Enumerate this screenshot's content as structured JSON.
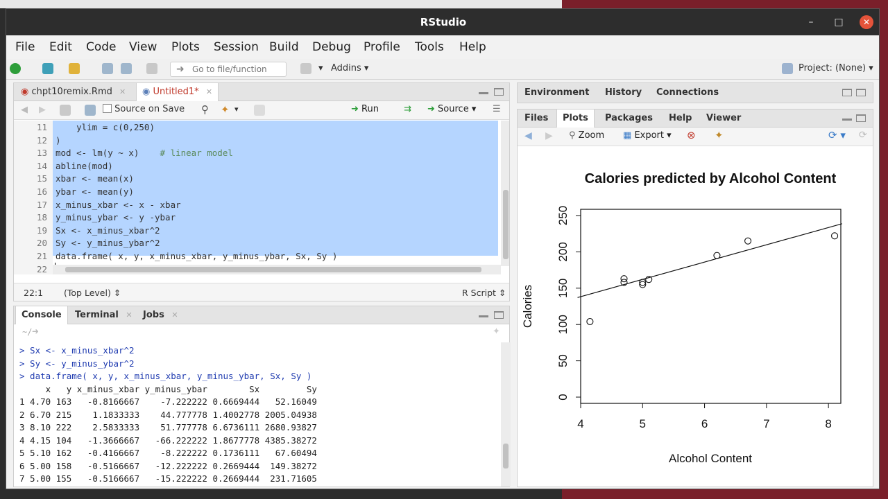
{
  "window": {
    "title": "RStudio"
  },
  "menu": [
    "File",
    "Edit",
    "Code",
    "View",
    "Plots",
    "Session",
    "Build",
    "Debug",
    "Profile",
    "Tools",
    "Help"
  ],
  "toolbar": {
    "goto_placeholder": "Go to file/function",
    "addins": "Addins",
    "project": "Project: (None)"
  },
  "editor": {
    "tabs": [
      {
        "label": "chpt10remix.Rmd"
      },
      {
        "label": "Untitled1*"
      }
    ],
    "source_on_save": "Source on Save",
    "run": "Run",
    "source": "Source",
    "lines": [
      {
        "n": "11",
        "code": "    ylim = c(0,250)",
        "comment": ""
      },
      {
        "n": "12",
        "code": ")",
        "comment": ""
      },
      {
        "n": "13",
        "code": "mod <- lm(y ~ x)    ",
        "comment": "# linear model"
      },
      {
        "n": "14",
        "code": "abline(mod)",
        "comment": ""
      },
      {
        "n": "15",
        "code": "xbar <- mean(x)",
        "comment": ""
      },
      {
        "n": "16",
        "code": "ybar <- mean(y)",
        "comment": ""
      },
      {
        "n": "17",
        "code": "x_minus_xbar <- x - xbar",
        "comment": ""
      },
      {
        "n": "18",
        "code": "y_minus_ybar <- y -ybar",
        "comment": ""
      },
      {
        "n": "19",
        "code": "Sx <- x_minus_xbar^2",
        "comment": ""
      },
      {
        "n": "20",
        "code": "Sy <- y_minus_ybar^2",
        "comment": ""
      },
      {
        "n": "21",
        "code": "data.frame( x, y, x_minus_xbar, y_minus_ybar, Sx, Sy )",
        "comment": ""
      },
      {
        "n": "22",
        "code": "",
        "comment": ""
      }
    ],
    "status": {
      "position": "22:1",
      "scope": "(Top Level)",
      "filetype": "R Script"
    }
  },
  "console": {
    "tabs": [
      {
        "label": "Console"
      },
      {
        "label": "Terminal"
      },
      {
        "label": "Jobs"
      }
    ],
    "path": "~/",
    "lines": [
      {
        "text": "> Sx <- x_minus_xbar^2",
        "cmd": true
      },
      {
        "text": "> Sy <- y_minus_ybar^2",
        "cmd": true
      },
      {
        "text": "> data.frame( x, y, x_minus_xbar, y_minus_ybar, Sx, Sy )",
        "cmd": true
      },
      {
        "text": "     x   y x_minus_xbar y_minus_ybar        Sx         Sy",
        "cmd": false
      },
      {
        "text": "1 4.70 163   -0.8166667    -7.222222 0.6669444   52.16049",
        "cmd": false
      },
      {
        "text": "2 6.70 215    1.1833333    44.777778 1.4002778 2005.04938",
        "cmd": false
      },
      {
        "text": "3 8.10 222    2.5833333    51.777778 6.6736111 2680.93827",
        "cmd": false
      },
      {
        "text": "4 4.15 104   -1.3666667   -66.222222 1.8677778 4385.38272",
        "cmd": false
      },
      {
        "text": "5 5.10 162   -0.4166667    -8.222222 0.1736111   67.60494",
        "cmd": false
      },
      {
        "text": "6 5.00 158   -0.5166667   -12.222222 0.2669444  149.38272",
        "cmd": false
      },
      {
        "text": "7 5.00 155   -0.5166667   -15.222222 0.2669444  231.71605",
        "cmd": false
      }
    ]
  },
  "env": {
    "tabs": [
      {
        "label": "Environment"
      },
      {
        "label": "History"
      },
      {
        "label": "Connections"
      }
    ]
  },
  "plots": {
    "tabs": [
      {
        "label": "Files"
      },
      {
        "label": "Plots"
      },
      {
        "label": "Packages"
      },
      {
        "label": "Help"
      },
      {
        "label": "Viewer"
      }
    ],
    "zoom": "Zoom",
    "export": "Export"
  },
  "chart_data": {
    "type": "scatter",
    "title": "Calories predicted by Alcohol Content",
    "xlabel": "Alcohol Content",
    "ylabel": "Calories",
    "xlim": [
      4,
      8.2
    ],
    "ylim": [
      0,
      250
    ],
    "xticks": [
      "4",
      "5",
      "6",
      "7",
      "8"
    ],
    "yticks": [
      "0",
      "50",
      "100",
      "150",
      "200",
      "250"
    ],
    "points": [
      {
        "x": 4.7,
        "y": 163
      },
      {
        "x": 6.7,
        "y": 215
      },
      {
        "x": 8.1,
        "y": 222
      },
      {
        "x": 4.15,
        "y": 104
      },
      {
        "x": 5.1,
        "y": 162
      },
      {
        "x": 5.0,
        "y": 158
      },
      {
        "x": 5.0,
        "y": 155
      },
      {
        "x": 4.7,
        "y": 158
      },
      {
        "x": 6.2,
        "y": 195
      }
    ],
    "fit_line": {
      "intercept": 43.1,
      "slope": 23.8
    }
  }
}
